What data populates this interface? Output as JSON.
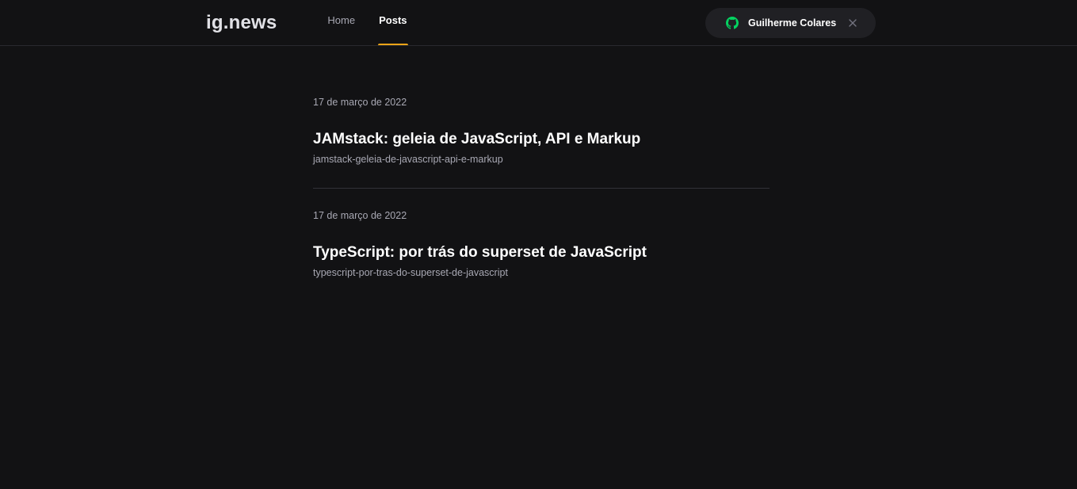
{
  "header": {
    "logo": "ig.news",
    "nav": [
      {
        "label": "Home",
        "active": false
      },
      {
        "label": "Posts",
        "active": true
      }
    ],
    "signin": {
      "user_name": "Guilherme Colares",
      "icon": "github-icon",
      "icon_color": "#04d361",
      "close_icon": "close-icon"
    },
    "active_indicator_color": "#eba417"
  },
  "posts": [
    {
      "date": "17 de março de 2022",
      "title": "JAMstack: geleia de JavaScript, API e Markup",
      "slug": "jamstack-geleia-de-javascript-api-e-markup"
    },
    {
      "date": "17 de março de 2022",
      "title": "TypeScript: por trás do superset de JavaScript",
      "slug": "typescript-por-tras-do-superset-de-javascript"
    }
  ]
}
